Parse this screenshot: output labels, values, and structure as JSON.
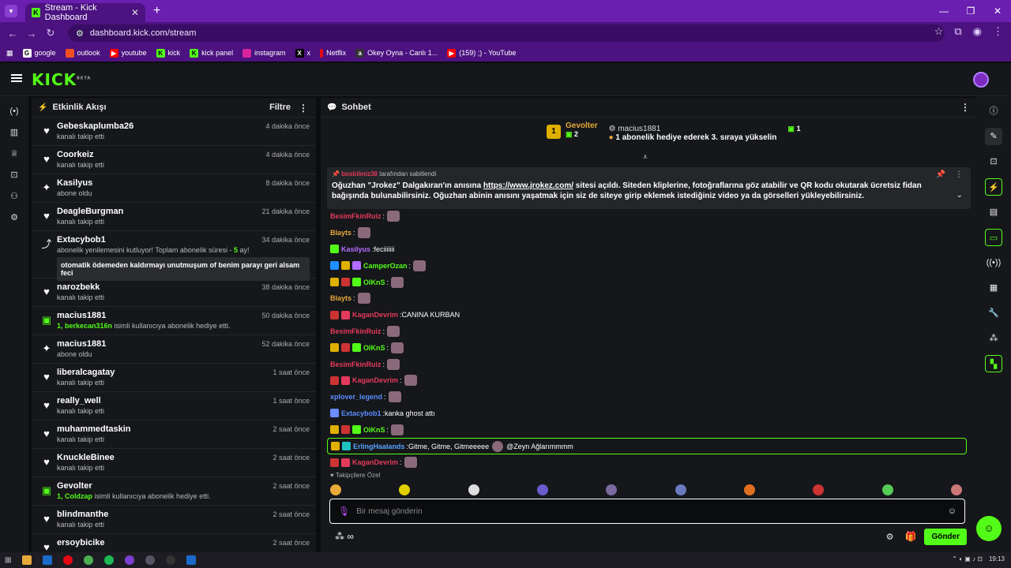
{
  "browser": {
    "tab_title": "Stream - Kick Dashboard",
    "url": "dashboard.kick.com/stream",
    "bookmarks": [
      "google",
      "outlook",
      "youtube",
      "kick",
      "kick panel",
      "instagram",
      "x",
      "Netflix",
      "Okey Oyna - Canlı 1...",
      "(159) ;) - YouTube"
    ]
  },
  "kick": {
    "logo": "KICK",
    "beta": "BETA"
  },
  "activity": {
    "title": "Etkinlik Akışı",
    "filter": "Filtre",
    "events": [
      {
        "name": "Gebeskaplumba26",
        "sub": "kanalı takip etti",
        "time": "4 dakika önce",
        "icon": "heart"
      },
      {
        "name": "Coorkeiz",
        "sub": "kanalı takip etti",
        "time": "4 dakika önce",
        "icon": "heart"
      },
      {
        "name": "Kasilyus",
        "sub": "abone oldu",
        "time": "8 dakika önce",
        "icon": "star"
      },
      {
        "name": "DeagleBurgman",
        "sub": "kanalı takip etti",
        "time": "21 dakika önce",
        "icon": "heart"
      },
      {
        "name": "Extacybob1",
        "sub_pre": "abonelik yenilemesini kutluyor! Toplam abonelik süresi - ",
        "sub_hl": "5",
        "sub_post": " ay!",
        "time": "34 dakika önce",
        "icon": "renew",
        "message": "otomatik ödemeden kaldırmayı unutmuşum of benim parayı geri alsam feci"
      },
      {
        "name": "narozbekk",
        "sub": "kanalı takip etti",
        "time": "38 dakika önce",
        "icon": "heart"
      },
      {
        "name": "macius1881",
        "sub_hl": "1, berkecan316n",
        "sub_post": " isimli kullanıcıya abonelik hediye etti.",
        "time": "50 dakika önce",
        "icon": "gift"
      },
      {
        "name": "macius1881",
        "sub": "abone oldu",
        "time": "52 dakika önce",
        "icon": "star"
      },
      {
        "name": "liberalcagatay",
        "sub": "kanalı takip etti",
        "time": "1 saat önce",
        "icon": "heart"
      },
      {
        "name": "really_well",
        "sub": "kanalı takip etti",
        "time": "1 saat önce",
        "icon": "heart"
      },
      {
        "name": "muhammedtaskin",
        "sub": "kanalı takip etti",
        "time": "2 saat önce",
        "icon": "heart"
      },
      {
        "name": "KnuckleBinee",
        "sub": "kanalı takip etti",
        "time": "2 saat önce",
        "icon": "heart"
      },
      {
        "name": "Gevolter",
        "sub_hl": "1, Coldzap",
        "sub_post": " isimli kullanıcıya abonelik hediye etti.",
        "time": "2 saat önce",
        "icon": "gift"
      },
      {
        "name": "blindmanthe",
        "sub": "kanalı takip etti",
        "time": "2 saat önce",
        "icon": "heart"
      },
      {
        "name": "ersoybicike",
        "sub": "",
        "time": "2 saat önce",
        "icon": "heart"
      }
    ]
  },
  "chat": {
    "title": "Sohbet",
    "leader1": {
      "rank": "1",
      "name": "Gevolter",
      "count": "2"
    },
    "leader2": {
      "name": "macius1881",
      "count": "1",
      "text": "1 abonelik hediye ederek 3. sıraya yükselin"
    },
    "pinned": {
      "by": "bosbilmiz38",
      "by_suffix": " tarafından sabitlendi",
      "text_pre": "Oğuzhan \"Jrokez\" Dalgakıran'ın anısına ",
      "link": "https://www.jrokez.com/",
      "text_post": " sitesi açıldı. Siteden kliplerine, fotoğraflarına göz atabilir ve QR kodu okutarak ücretsiz fidan bağışında bulunabilirsiniz. Oğuzhan abinin anısını yaşatmak için siz de siteye girip eklemek istediğiniz video ya da görselleri yükleyebilirsiniz."
    },
    "messages": [
      {
        "user": "BesimFkinRuiz",
        "color": "#e43a5c",
        "text": "",
        "emote": true,
        "badges": []
      },
      {
        "user": "Blayts",
        "color": "#e7a93a",
        "text": "",
        "emote": true,
        "badges": []
      },
      {
        "user": "Kasilyus",
        "color": "#b36cff",
        "text": "feciiiiiii",
        "emote": false,
        "badges": [
          "#53fc18"
        ]
      },
      {
        "user": "CamperOzan",
        "color": "#53fc18",
        "text": "",
        "emote": true,
        "badges": [
          "#1e90ff",
          "#e0b000",
          "#b36cff"
        ]
      },
      {
        "user": "OIKnS",
        "color": "#53fc18",
        "text": "",
        "emote": true,
        "badges": [
          "#e0b000",
          "#c33",
          "#53fc18"
        ]
      },
      {
        "user": "Blayts",
        "color": "#e7a93a",
        "text": "",
        "emote": true,
        "badges": []
      },
      {
        "user": "KaganDevrim",
        "color": "#e43a5c",
        "text": "CANINA KURBAN",
        "emote": false,
        "badges": [
          "#c33",
          "#e43a5c"
        ]
      },
      {
        "user": "BesimFkinRuiz",
        "color": "#e43a5c",
        "text": "",
        "emote": true,
        "badges": []
      },
      {
        "user": "OIKnS",
        "color": "#53fc18",
        "text": "",
        "emote": true,
        "badges": [
          "#e0b000",
          "#c33",
          "#53fc18"
        ]
      },
      {
        "user": "BesimFkinRuiz",
        "color": "#e43a5c",
        "text": "",
        "emote": true,
        "badges": []
      },
      {
        "user": "KaganDevrim",
        "color": "#e43a5c",
        "text": "",
        "emote": true,
        "badges": [
          "#c33",
          "#e43a5c"
        ]
      },
      {
        "user": "xplover_legend",
        "color": "#5a8cff",
        "text": "",
        "emote": true,
        "badges": []
      },
      {
        "user": "Extacybob1",
        "color": "#5a8cff",
        "text": "kanka ghost attı",
        "emote": false,
        "badges": [
          "#6a8cff"
        ]
      },
      {
        "user": "OIKnS",
        "color": "#53fc18",
        "text": "",
        "emote": true,
        "badges": [
          "#e0b000",
          "#c33",
          "#53fc18"
        ]
      },
      {
        "user": "ErlingHaalands",
        "color": "#5aa0ff",
        "text": "Gitme, Gitme, Gitmeeeee",
        "text2": "@Zeyn Ağlarımmmm",
        "emote": false,
        "badges": [
          "#e0b000",
          "#20c0c0"
        ],
        "highlight": true
      },
      {
        "user": "KaganDevrim",
        "color": "#e43a5c",
        "text": "",
        "emote": true,
        "badges": [
          "#c33",
          "#e43a5c"
        ]
      }
    ],
    "followers_label": "Takipçilere Özel",
    "placeholder": "Bir mesaj gönderin",
    "send": "Gönder"
  },
  "taskbar": {
    "time": "19:13"
  }
}
